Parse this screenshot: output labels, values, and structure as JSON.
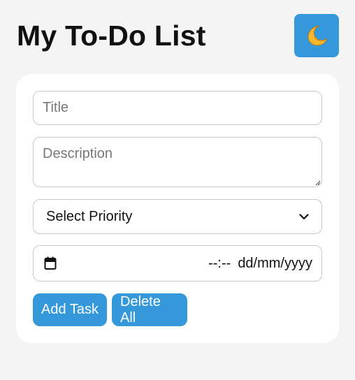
{
  "header": {
    "title": "My To-Do List",
    "theme_toggle_icon": "crescent-moon-icon"
  },
  "form": {
    "title_placeholder": "Title",
    "description_placeholder": "Description",
    "priority_selected": "Select Priority",
    "time_value": "--:--",
    "date_value": "dd/mm/yyyy",
    "date_icon": "calendar-icon"
  },
  "actions": {
    "add_label": "Add Task",
    "delete_label": "Delete All"
  },
  "colors": {
    "accent": "#3498db",
    "page_background": "#f4f4f4",
    "card_background": "#ffffff",
    "moon": "#f5b82e"
  }
}
